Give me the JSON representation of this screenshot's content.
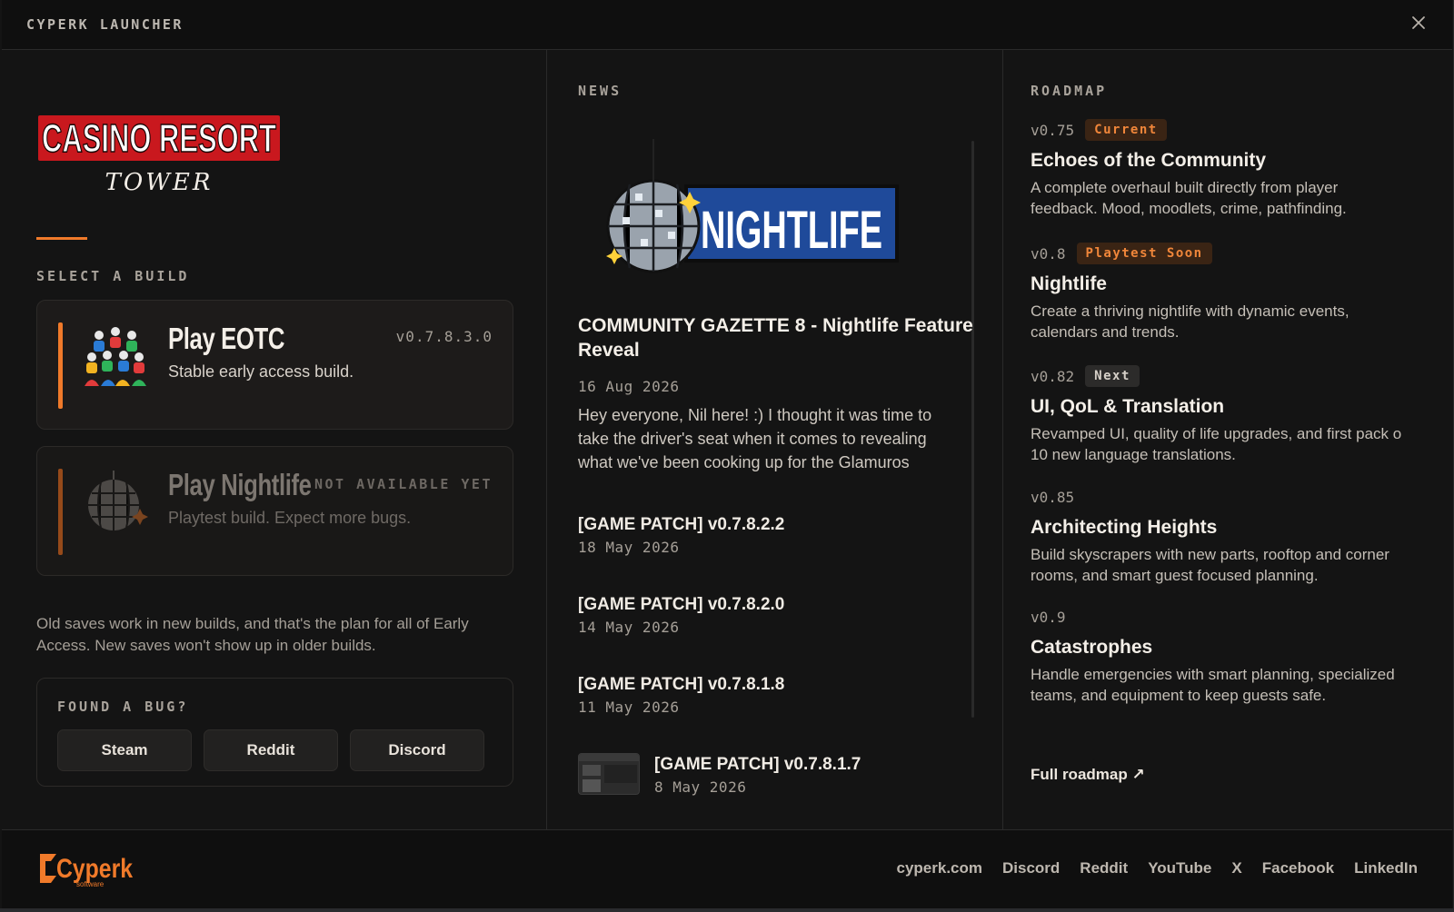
{
  "app": {
    "title": "CYPERK LAUNCHER"
  },
  "logo": {
    "line1": "CASINO RESORT",
    "line2": "TOWER"
  },
  "builds": {
    "section_label": "SELECT A BUILD",
    "items": [
      {
        "title": "Play EOTC",
        "version": "v0.7.8.3.0",
        "desc": "Stable early access build."
      },
      {
        "title": "Play Nightlife",
        "status": "NOT AVAILABLE YET",
        "desc": "Playtest build. Expect more bugs."
      }
    ],
    "note": "Old saves work in new builds, and that's the plan for all of Early Access. New saves won't show up in older builds."
  },
  "bug": {
    "label": "FOUND A BUG?",
    "buttons": [
      "Steam",
      "Reddit",
      "Discord"
    ]
  },
  "news": {
    "section_label": "NEWS",
    "hero_text": "NIGHTLIFE",
    "headline": "COMMUNITY GAZETTE 8 - Nightlife Feature Reveal",
    "date": "16 Aug 2026",
    "body": "Hey everyone, Nil here! :) I thought it was time to take the driver's seat when it comes to revealing what we've been cooking up for the Glamuros",
    "patches": [
      {
        "title": "[GAME PATCH] v0.7.8.2.2",
        "date": "18 May 2026"
      },
      {
        "title": "[GAME PATCH] v0.7.8.2.0",
        "date": "14 May 2026"
      },
      {
        "title": "[GAME PATCH] v0.7.8.1.8",
        "date": "11 May 2026"
      },
      {
        "title": "[GAME PATCH] v0.7.8.1.7",
        "date": "8 May 2026"
      }
    ]
  },
  "roadmap": {
    "section_label": "ROADMAP",
    "items": [
      {
        "version": "v0.75",
        "badge": "Current",
        "title": "Echoes of the Community",
        "desc": [
          "A complete overhaul built directly from player",
          "feedback. Mood, moodlets, crime, pathfinding."
        ]
      },
      {
        "version": "v0.8",
        "badge": "Playtest Soon",
        "title": "Nightlife",
        "desc": [
          "Create a thriving nightlife with dynamic events,",
          "calendars and trends."
        ]
      },
      {
        "version": "v0.82",
        "badge": "Next",
        "title": "UI, QoL & Translation",
        "desc": [
          "Revamped UI, quality of life upgrades, and first pack o",
          "10 new language translations."
        ]
      },
      {
        "version": "v0.85",
        "badge": "",
        "title": "Architecting Heights",
        "desc": [
          "Build skyscrapers with new parts, rooftop and corner",
          "rooms, and smart guest focused planning."
        ]
      },
      {
        "version": "v0.9",
        "badge": "",
        "title": "Catastrophes",
        "desc": [
          "Handle emergencies with smart planning, specialized",
          "teams, and equipment to keep guests safe."
        ]
      }
    ],
    "full_link": "Full roadmap ↗"
  },
  "footer": {
    "logo_text": "Cyperk",
    "logo_sub": "software",
    "links": [
      "cyperk.com",
      "Discord",
      "Reddit",
      "YouTube",
      "X",
      "Facebook",
      "LinkedIn"
    ]
  },
  "colors": {
    "accent": "#f07a2a",
    "background": "#141414"
  }
}
